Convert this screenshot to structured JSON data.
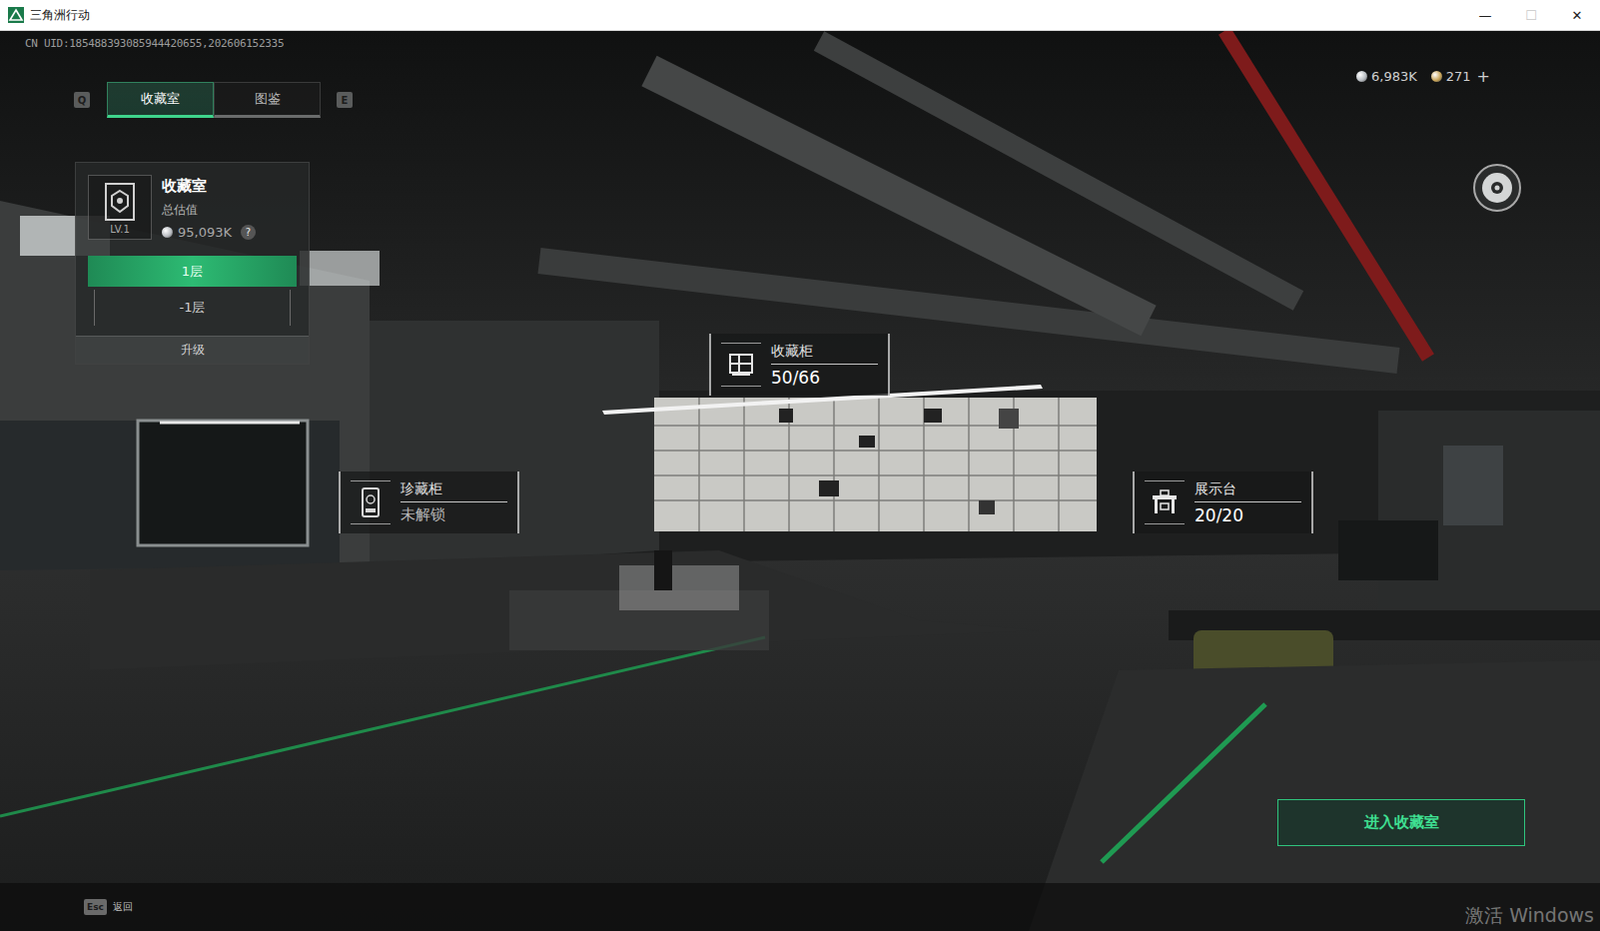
{
  "window": {
    "title": "三角洲行动",
    "controls": [
      {
        "glyph": "—",
        "disabled": false
      },
      {
        "glyph": "☐",
        "disabled": true
      },
      {
        "glyph": "✕",
        "disabled": false
      }
    ]
  },
  "uid": "CN UID:185488393085944420655,202606152335",
  "tabs": {
    "prev_key": "Q",
    "next_key": "E",
    "items": [
      {
        "label": "收藏室",
        "selected": true
      },
      {
        "label": "图鉴",
        "selected": false
      }
    ]
  },
  "currencies": [
    {
      "amount": "6,983K",
      "color": "#b9bdc2"
    },
    {
      "amount": "271",
      "color": "#c9a55a"
    }
  ],
  "add": "+",
  "collection_panel": {
    "title": "收藏室",
    "level": "LV.1",
    "value_label": "总估值",
    "value": "95,093K",
    "help": "?",
    "floors": [
      {
        "label": "1层",
        "selected": true
      },
      {
        "label": "-1层",
        "selected": false
      }
    ],
    "upgrade": "升级"
  },
  "hotspots": [
    {
      "kind": "cabinet",
      "name": "收藏柜",
      "value": "50/66",
      "locked": false
    },
    {
      "kind": "vault",
      "name": "珍藏柜",
      "value": "未解锁",
      "locked": true
    },
    {
      "kind": "display",
      "name": "展示台",
      "value": "20/20",
      "locked": false
    }
  ],
  "enter_button": "进入收藏室",
  "back": {
    "key": "Esc",
    "label": "返回"
  },
  "watermark": "激活 Windows"
}
